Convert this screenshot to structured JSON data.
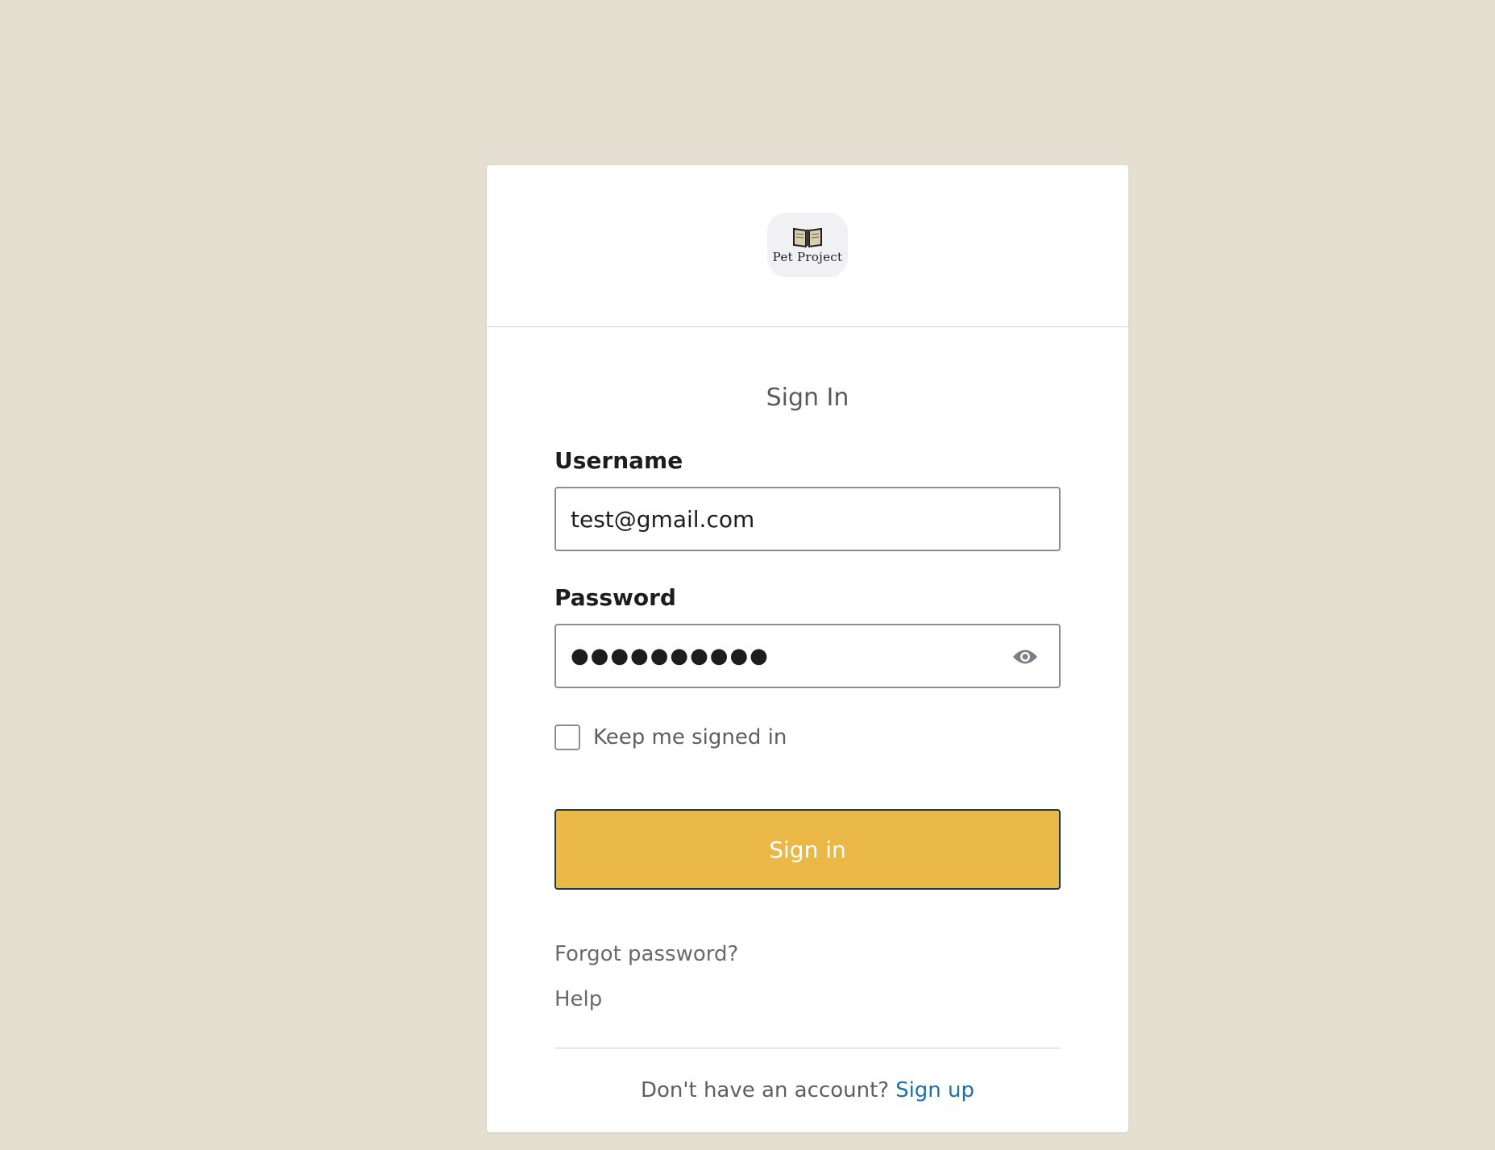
{
  "logo": {
    "icon": "open-book-icon",
    "text": "Pet Project"
  },
  "form": {
    "title": "Sign In",
    "username": {
      "label": "Username",
      "value": "test@gmail.com"
    },
    "password": {
      "label": "Password",
      "masked_value": "●●●●●●●●●●",
      "reveal_icon": "eye-icon"
    },
    "remember": {
      "label": "Keep me signed in",
      "checked": false
    },
    "submit_label": "Sign in",
    "forgot_label": "Forgot password?",
    "help_label": "Help"
  },
  "footer": {
    "prompt": "Don't have an account?",
    "signup_label": "Sign up"
  },
  "colors": {
    "background": "#e4dfd1",
    "button": "#eab846",
    "link": "#1f6fad"
  }
}
